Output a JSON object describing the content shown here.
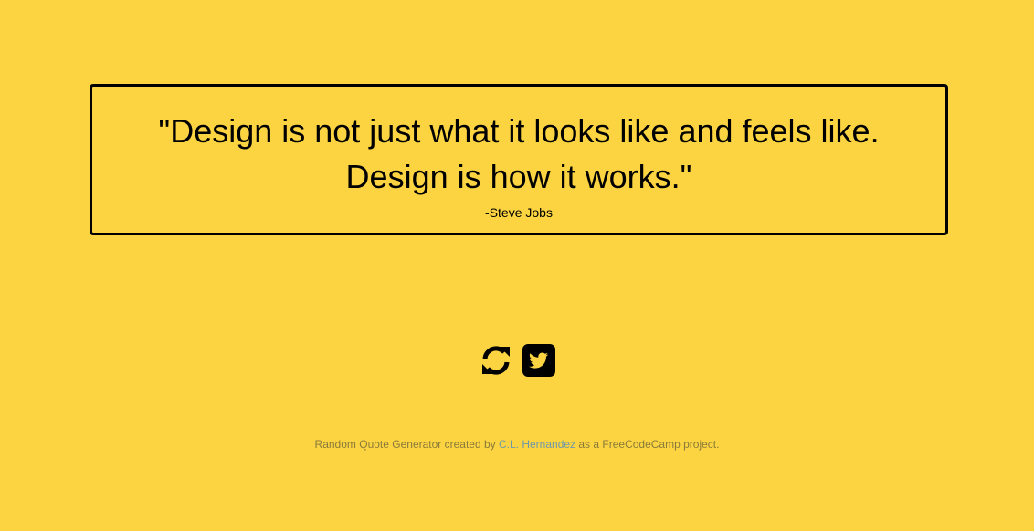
{
  "quote": {
    "text": "\"Design is not just what it looks like and feels like. Design is how it works.\"",
    "author": "-Steve Jobs"
  },
  "controls": {
    "new_quote_icon": "refresh-icon",
    "tweet_icon": "twitter-icon"
  },
  "footer": {
    "prefix": "Random Quote Generator created by ",
    "author_link": "C.L. Hernandez",
    "suffix": " as a FreeCodeCamp project."
  },
  "colors": {
    "background": "#fcd442",
    "text": "#000000",
    "footer_text": "#8a7a3a",
    "link": "#6f97a8"
  }
}
